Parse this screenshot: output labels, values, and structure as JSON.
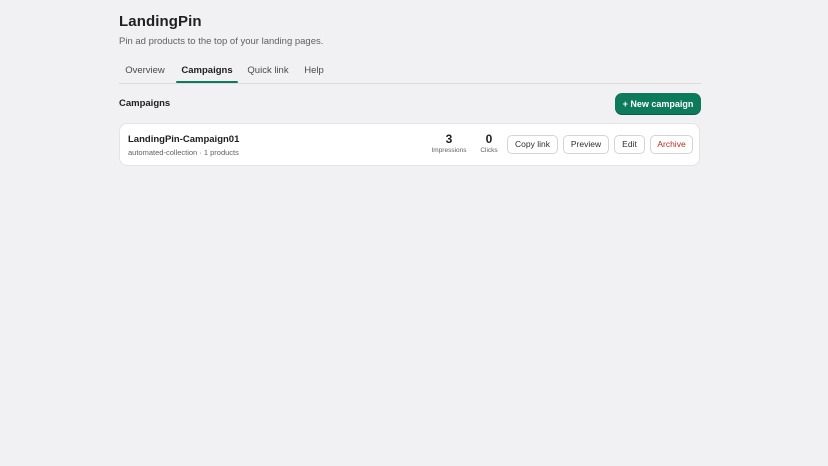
{
  "app": {
    "title": "LandingPin",
    "subtitle": "Pin ad products to the top of your landing pages."
  },
  "tabs": [
    {
      "label": "Overview",
      "active": false
    },
    {
      "label": "Campaigns",
      "active": true
    },
    {
      "label": "Quick link",
      "active": false
    },
    {
      "label": "Help",
      "active": false
    }
  ],
  "campaigns_section": {
    "title": "Campaigns",
    "new_button_label": "+ New campaign"
  },
  "campaign_rows": [
    {
      "name": "LandingPin-Campaign01",
      "meta": "automated-collection · 1 products",
      "impressions_value": "3",
      "impressions_label": "Impressions",
      "clicks_value": "0",
      "clicks_label": "Clicks",
      "actions": {
        "copy_link": "Copy link",
        "preview": "Preview",
        "edit": "Edit",
        "archive": "Archive"
      }
    }
  ],
  "colors": {
    "accent": "#0e7a5c",
    "danger": "#b42e1a",
    "background": "#f1f1f3"
  }
}
